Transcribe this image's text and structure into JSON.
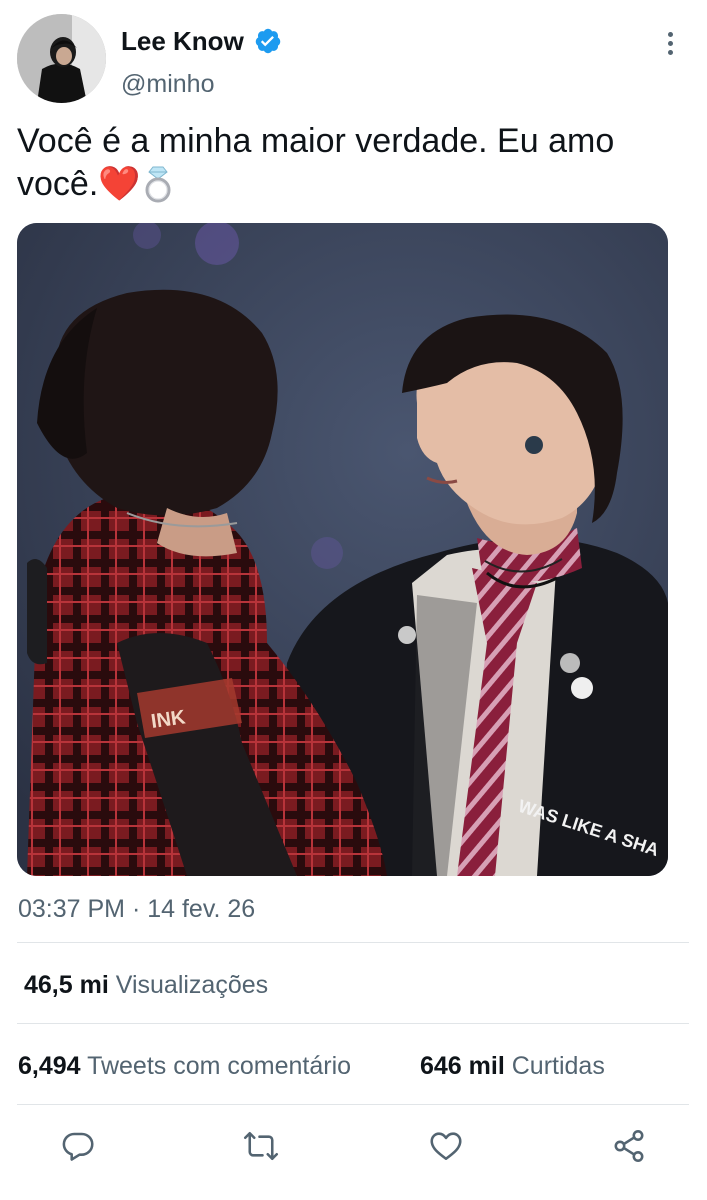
{
  "user": {
    "display_name": "Lee Know",
    "handle": "@minho",
    "verified": true
  },
  "tweet": {
    "text": "Você é a minha maior verdade. Eu amo você.",
    "emojis": [
      "❤️",
      "💍"
    ],
    "timestamp": "03:37 PM · 14 fev. 26"
  },
  "media": {
    "caption_on_jacket": "WAS LIKE A SHA"
  },
  "stats": {
    "views_count": "46,5 mi",
    "views_label": "Visualizações",
    "quotes_count": "6,494",
    "quotes_label": "Tweets com comentário",
    "likes_count": "646 mil",
    "likes_label": "Curtidas"
  },
  "actions": {
    "icons": [
      "reply-icon",
      "retweet-icon",
      "like-icon",
      "share-icon"
    ]
  },
  "colors": {
    "text": "#0f1419",
    "secondary": "#536471",
    "verified_blue": "#1d9bf0",
    "divider": "#e1e5e8"
  }
}
